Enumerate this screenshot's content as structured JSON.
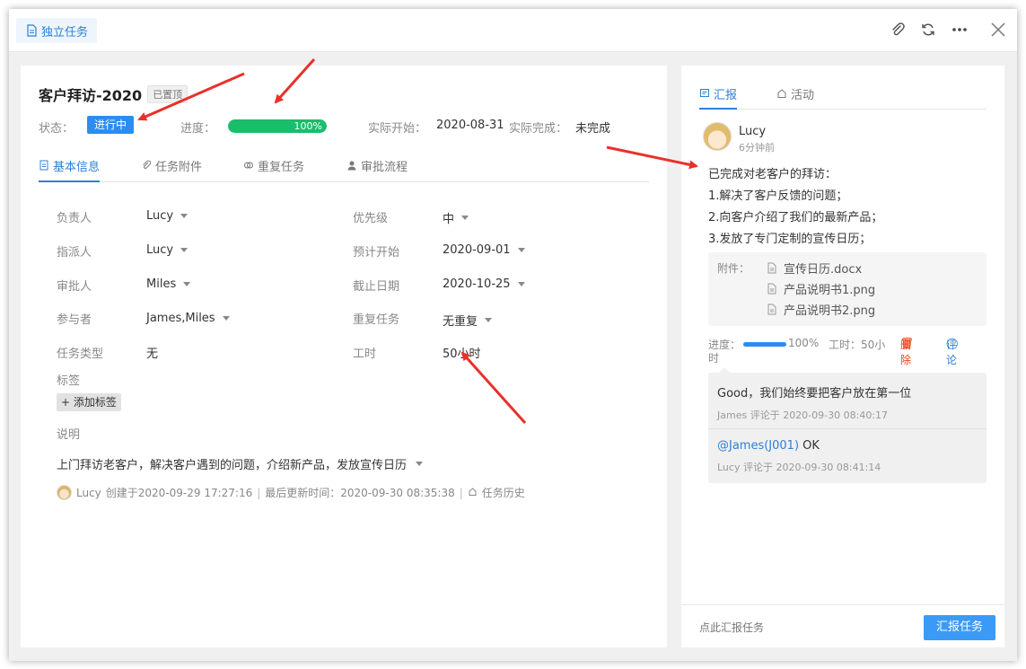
{
  "window": {
    "title_tag": "独立任务",
    "icons": [
      "paperclip-icon",
      "refresh-icon",
      "more-icon",
      "close-icon"
    ]
  },
  "task": {
    "title": "客户拜访-2020",
    "pinned_badge": "已置顶",
    "status_label": "状态：",
    "status_value": "进行中",
    "progress_label": "进度：",
    "progress_value": "100%",
    "progress_fraction": 1.0,
    "actual_start_label": "实际开始：",
    "actual_start_value": "2020-08-31",
    "actual_finish_label": "实际完成：",
    "actual_finish_value": "未完成"
  },
  "tabs": [
    {
      "label": "基本信息",
      "icon": "doc-icon",
      "active": true
    },
    {
      "label": "任务附件",
      "icon": "paperclip-icon",
      "active": false
    },
    {
      "label": "重复任务",
      "icon": "repeat-icon",
      "active": false
    },
    {
      "label": "审批流程",
      "icon": "user-icon",
      "active": false
    }
  ],
  "fields_left": [
    {
      "label": "负责人",
      "value": "Lucy",
      "dropdown": true
    },
    {
      "label": "指派人",
      "value": "Lucy",
      "dropdown": true
    },
    {
      "label": "审批人",
      "value": "Miles",
      "dropdown": true
    },
    {
      "label": "参与者",
      "value": "James,Miles",
      "dropdown": true
    },
    {
      "label": "任务类型",
      "value": "无",
      "dropdown": false
    }
  ],
  "fields_right": [
    {
      "label": "优先级",
      "value": "中",
      "dropdown": true
    },
    {
      "label": "预计开始",
      "value": "2020-09-01",
      "dropdown": true
    },
    {
      "label": "截止日期",
      "value": "2020-10-25",
      "dropdown": true
    },
    {
      "label": "重复任务",
      "value": "无重复",
      "dropdown": true
    },
    {
      "label": "工时",
      "value": "50小时",
      "dropdown": false
    }
  ],
  "tags": {
    "label": "标签",
    "add_button": "添加标签"
  },
  "description": {
    "label": "说明",
    "text": "上门拜访老客户，解决客户遇到的问题，介绍新产品，发放宣传日历"
  },
  "footer": {
    "user": "Lucy",
    "created": "创建于2020-09-29 17:27:16",
    "updated": "最后更新时间：2020-09-30 08:35:38",
    "history": "任务历史"
  },
  "report_panel": {
    "tabs": [
      {
        "label": "汇报",
        "active": true
      },
      {
        "label": "活动",
        "active": false
      }
    ],
    "report": {
      "user": "Lucy",
      "time": "6分钟前",
      "lines": [
        "已完成对老客户的拜访：",
        "1.解决了客户反馈的问题；",
        "2.向客户介绍了我们的最新产品；",
        "3.发放了专门定制的宣传日历；"
      ],
      "attachments_label": "附件：",
      "attachments": [
        "宣传日历.docx",
        "产品说明书1.png",
        "产品说明书2.png"
      ],
      "progress_label": "进度：",
      "progress_value": "100%",
      "hours_label": "工时：50小",
      "hours_wrap": "时",
      "delete_label": "删除",
      "comment_label": "评论"
    },
    "comments": [
      {
        "text": "Good，我们始终要把客户放在第一位",
        "meta": "James 评论于 2020-09-30 08:40:17"
      },
      {
        "mention": "@James(J001)",
        "text": " OK",
        "meta": "Lucy 评论于 2020-09-30 08:41:14"
      }
    ],
    "bottom_hint": "点此汇报任务",
    "report_button": "汇报任务"
  },
  "colors": {
    "accent": "#2d7fd8",
    "status_badge": "#2d8cf0",
    "progress_green": "#19be6b",
    "annotation_arrow": "#e8312a",
    "delete_red": "#ed4014"
  }
}
